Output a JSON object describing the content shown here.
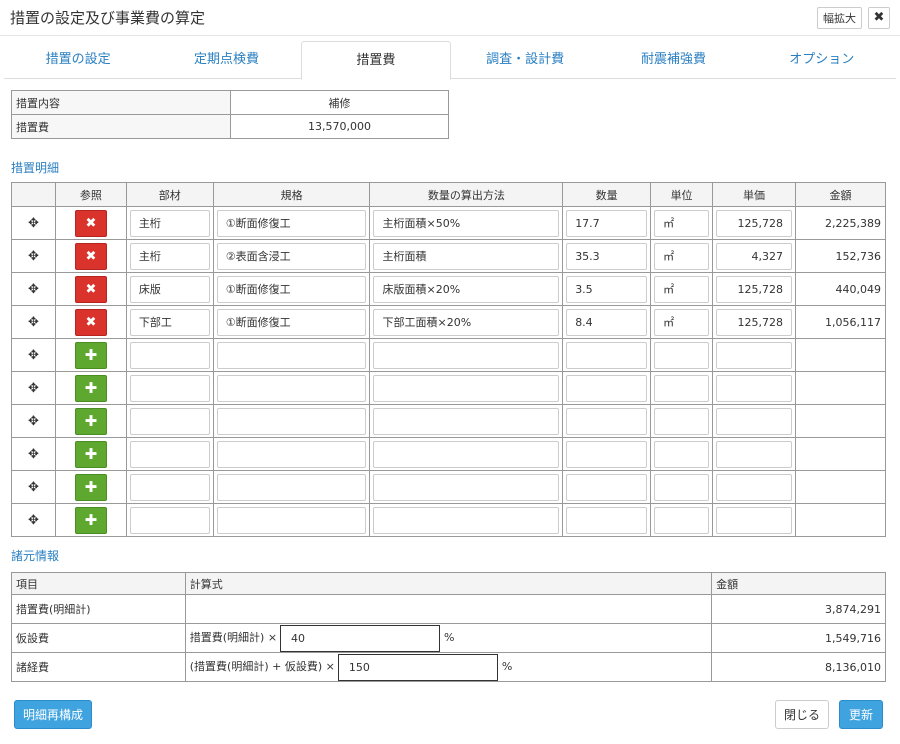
{
  "window": {
    "title": "措置の設定及び事業費の算定",
    "maximize_label": "幅拡大",
    "close_glyph": "✖"
  },
  "tabs": [
    {
      "label": "措置の設定",
      "active": false
    },
    {
      "label": "定期点検費",
      "active": false
    },
    {
      "label": "措置費",
      "active": true
    },
    {
      "label": "調査・設計費",
      "active": false
    },
    {
      "label": "耐震補強費",
      "active": false
    },
    {
      "label": "オプション",
      "active": false
    }
  ],
  "summary": {
    "type_label": "措置内容",
    "type_value": "補修",
    "cost_label": "措置費",
    "cost_value": "13,570,000"
  },
  "detail": {
    "section_title": "措置明細",
    "headers": [
      "",
      "参照",
      "部材",
      "規格",
      "数量の算出方法",
      "数量",
      "単位",
      "単価",
      "金額"
    ],
    "rows": [
      {
        "member": "主桁",
        "spec": "①断面修復工",
        "method": "主桁面積×50%",
        "qty": "17.7",
        "unit": "㎡",
        "price": "125,728",
        "amount": "2,225,389"
      },
      {
        "member": "主桁",
        "spec": "②表面含浸工",
        "method": "主桁面積",
        "qty": "35.3",
        "unit": "㎡",
        "price": "4,327",
        "amount": "152,736"
      },
      {
        "member": "床版",
        "spec": "①断面修復工",
        "method": "床版面積×20%",
        "qty": "3.5",
        "unit": "㎡",
        "price": "125,728",
        "amount": "440,049"
      },
      {
        "member": "下部工",
        "spec": "①断面修復工",
        "method": "下部工面積×20%",
        "qty": "8.4",
        "unit": "㎡",
        "price": "125,728",
        "amount": "1,056,117"
      }
    ],
    "empty_rows": 6,
    "move_glyph": "✥",
    "delete_glyph": "✖",
    "add_glyph": "✚"
  },
  "spec_info": {
    "section_title": "諸元情報",
    "headers": {
      "item": "項目",
      "formula": "計算式",
      "amount": "金額"
    },
    "rows": [
      {
        "item": "措置費(明細計)",
        "formula_prefix": "",
        "input": "",
        "suffix": "",
        "amount": "3,874,291"
      },
      {
        "item": "仮設費",
        "formula_prefix": "措置費(明細計) ×",
        "input": "40",
        "suffix": "%",
        "amount": "1,549,716"
      },
      {
        "item": "諸経費",
        "formula_prefix": "(措置費(明細計) + 仮設費) ×",
        "input": "150",
        "suffix": "%",
        "amount": "8,136,010"
      }
    ]
  },
  "buttons": {
    "rebuild": "明細再構成",
    "close": "閉じる",
    "update": "更新"
  },
  "colors": {
    "accent": "#3fa3e0",
    "link": "#2a7fc1",
    "delete": "#d9332c",
    "add": "#5ea82f"
  }
}
